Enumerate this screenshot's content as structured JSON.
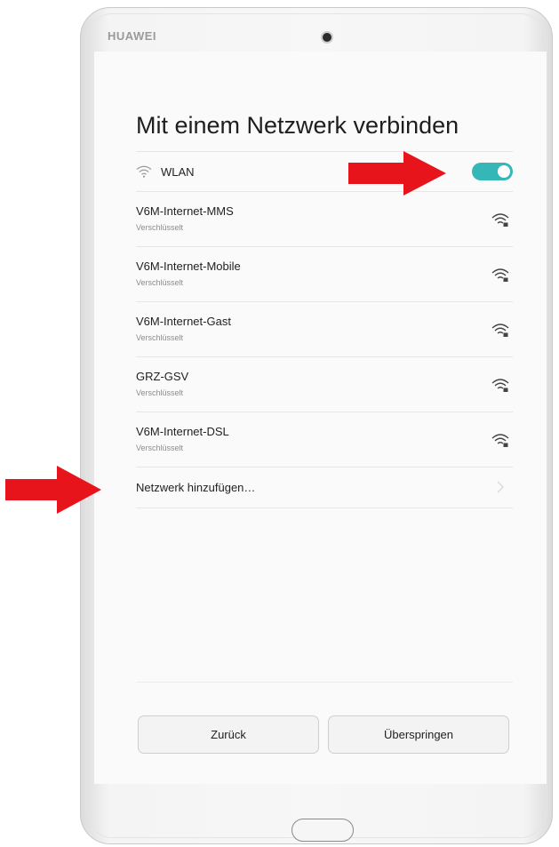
{
  "device": {
    "brand": "HUAWEI"
  },
  "screen": {
    "title": "Mit einem Netzwerk verbinden",
    "wlan": {
      "label": "WLAN",
      "icon": "wifi-icon",
      "enabled": true,
      "toggle_color": "#36b7b7"
    },
    "networks": [
      {
        "name": "V6M-Internet-MMS",
        "status": "Verschlüsselt",
        "icon": "wifi-signal-locked-icon"
      },
      {
        "name": "V6M-Internet-Mobile",
        "status": "Verschlüsselt",
        "icon": "wifi-signal-locked-icon"
      },
      {
        "name": "V6M-Internet-Gast",
        "status": "Verschlüsselt",
        "icon": "wifi-signal-locked-icon"
      },
      {
        "name": "GRZ-GSV",
        "status": "Verschlüsselt",
        "icon": "wifi-signal-locked-icon"
      },
      {
        "name": "V6M-Internet-DSL",
        "status": "Verschlüsselt",
        "icon": "wifi-signal-locked-icon"
      }
    ],
    "add_network": {
      "label": "Netzwerk hinzufügen…",
      "icon": "chevron-right-icon"
    },
    "buttons": {
      "back": "Zurück",
      "skip": "Überspringen"
    }
  },
  "annotations": {
    "arrow_color": "#e8141b"
  }
}
